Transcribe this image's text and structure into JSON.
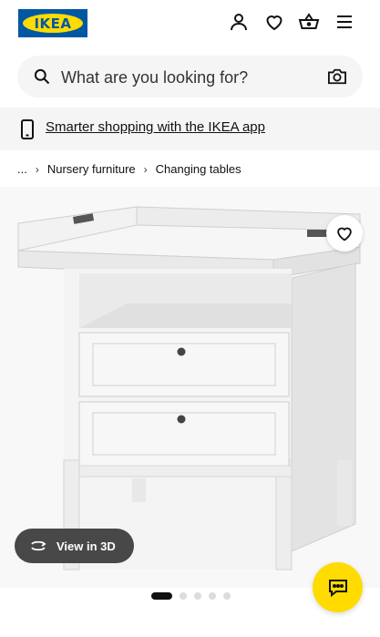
{
  "brand": {
    "logo_text": "IKEA",
    "blue": "#0058a3",
    "yellow": "#ffdb00"
  },
  "header": {
    "icons": [
      "user-icon",
      "heart-icon",
      "basket-icon",
      "menu-icon"
    ]
  },
  "search": {
    "placeholder": "What are you looking for?",
    "value": ""
  },
  "banner": {
    "text": "Smarter shopping with the IKEA app"
  },
  "breadcrumb": {
    "items": [
      "...",
      "Nursery furniture",
      "Changing tables"
    ]
  },
  "gallery": {
    "view_3d_label": "View in 3D",
    "pages": 5,
    "active_page": 1
  }
}
